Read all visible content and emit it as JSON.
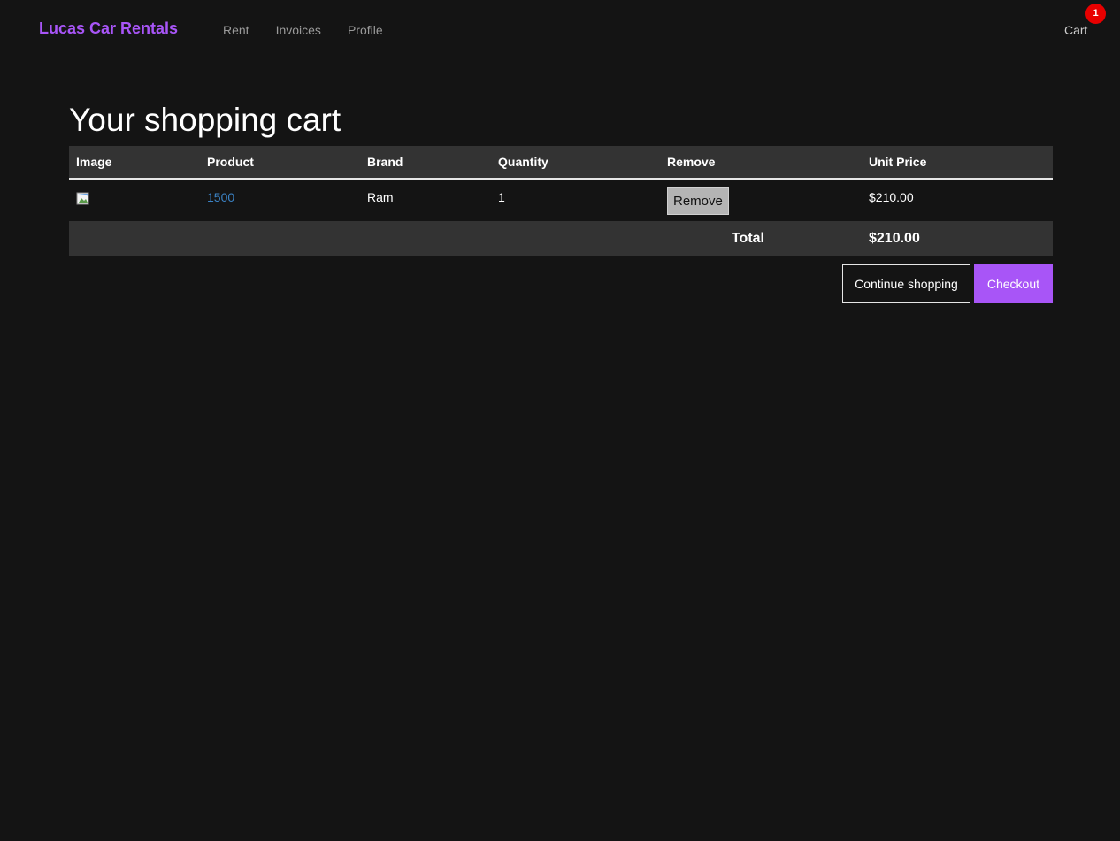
{
  "navbar": {
    "brand": "Lucas Car Rentals",
    "links": [
      "Rent",
      "Invoices",
      "Profile"
    ],
    "cart_label": "Cart",
    "cart_count": "1"
  },
  "cart": {
    "title": "Your shopping cart",
    "columns": [
      "Image",
      "Product",
      "Brand",
      "Quantity",
      "Remove",
      "Unit Price"
    ],
    "rows": [
      {
        "product": "1500",
        "brand": "Ram",
        "quantity": "1",
        "remove_label": "Remove",
        "unit_price": "$210.00"
      }
    ],
    "total_label": "Total",
    "total_value": "$210.00",
    "continue_label": "Continue shopping",
    "checkout_label": "Checkout"
  },
  "colors": {
    "background": "#141414",
    "accent": "#a855f7",
    "badge": "#e80000",
    "table_header": "#333333",
    "link": "#3b82c4"
  }
}
